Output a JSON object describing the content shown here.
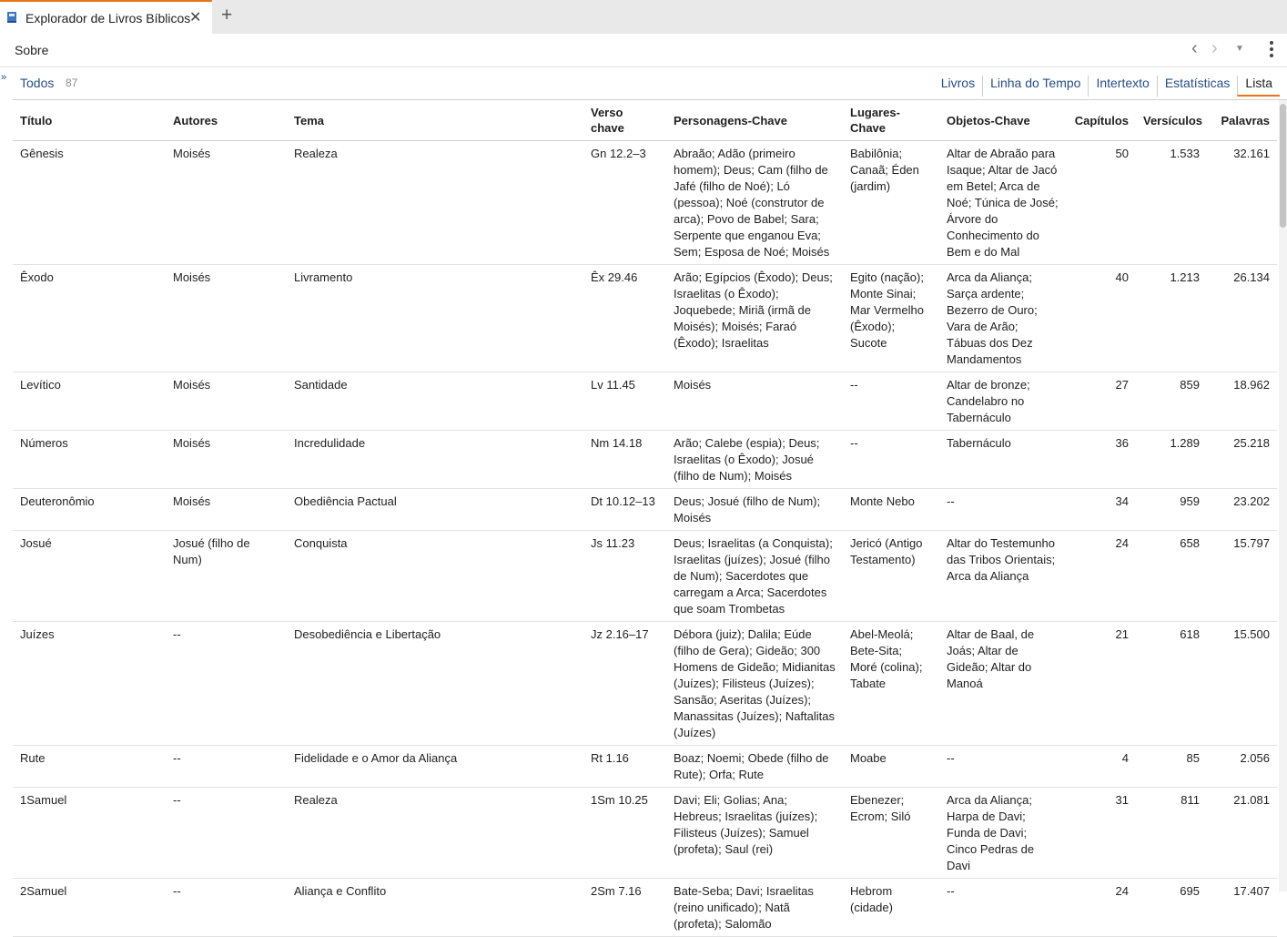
{
  "tab": {
    "title": "Explorador de Livros Bíblicos",
    "close_icon": "✕",
    "new_tab_icon": "+"
  },
  "toolbar": {
    "title": "Sobre",
    "back_icon": "‹",
    "forward_icon": "›",
    "dropdown_icon": "▼"
  },
  "sidebar_toggle_icon": "»",
  "filter": {
    "label": "Todos",
    "count": "87"
  },
  "views": [
    "Livros",
    "Linha do Tempo",
    "Intertexto",
    "Estatísticas",
    "Lista"
  ],
  "active_view": "Lista",
  "colors": {
    "accent": "#e8751a",
    "link": "#274f85"
  },
  "table": {
    "headers": {
      "title": "Título",
      "authors": "Autores",
      "theme": "Tema",
      "key_verse": "Verso chave",
      "characters": "Personagens-Chave",
      "places": "Lugares-Chave",
      "objects": "Objetos-Chave",
      "chapters": "Capítulos",
      "verses": "Versículos",
      "words": "Palavras"
    },
    "rows": [
      {
        "title": "Gênesis",
        "authors": "Moisés",
        "theme": "Realeza",
        "key_verse": "Gn 12.2–3",
        "characters": "Abraão; Adão (primeiro homem); Deus; Cam (filho de Jafé (filho de Noé); Ló (pessoa); Noé (construtor de arca); Povo de Babel; Sara; Serpente que enganou Eva; Sem; Esposa de Noé; Moisés",
        "places": "Babilônia; Canaã; Éden (jardim)",
        "objects": "Altar de Abraão para Isaque; Altar de Jacó em Betel; Arca de Noé; Túnica de José; Árvore do Conhecimento do Bem e do Mal",
        "chapters": "50",
        "verses": "1.533",
        "words": "32.161"
      },
      {
        "title": "Êxodo",
        "authors": "Moisés",
        "theme": "Livramento",
        "key_verse": "Êx 29.46",
        "characters": "Arão; Egípcios (Êxodo); Deus; Israelitas (o Êxodo); Joquebede; Miriã (irmã de Moisés); Moisés; Faraó (Êxodo); Israelitas",
        "places": "Egito (nação); Monte Sinai; Mar Vermelho (Êxodo); Sucote",
        "objects": "Arca da Aliança; Sarça ardente; Bezerro de Ouro; Vara de Arão; Tábuas dos Dez Mandamentos",
        "chapters": "40",
        "verses": "1.213",
        "words": "26.134"
      },
      {
        "title": "Levítico",
        "authors": "Moisés",
        "theme": "Santidade",
        "key_verse": "Lv 11.45",
        "characters": "Moisés",
        "places": "--",
        "objects": "Altar de bronze; Candelabro no Tabernáculo",
        "chapters": "27",
        "verses": "859",
        "words": "18.962"
      },
      {
        "title": "Números",
        "authors": "Moisés",
        "theme": "Incredulidade",
        "key_verse": "Nm 14.18",
        "characters": "Arão; Calebe (espia); Deus; Israelitas (o Êxodo); Josué (filho de Num); Moisés",
        "places": "--",
        "objects": "Tabernáculo",
        "chapters": "36",
        "verses": "1.289",
        "words": "25.218"
      },
      {
        "title": "Deuteronômio",
        "authors": "Moisés",
        "theme": "Obediência Pactual",
        "key_verse": "Dt 10.12–13",
        "characters": "Deus; Josué (filho de Num); Moisés",
        "places": "Monte Nebo",
        "objects": "--",
        "chapters": "34",
        "verses": "959",
        "words": "23.202"
      },
      {
        "title": "Josué",
        "authors": "Josué (filho de Num)",
        "theme": "Conquista",
        "key_verse": "Js 11.23",
        "characters": "Deus; Israelitas (a Conquista); Israelitas (juízes); Josué (filho de Num); Sacerdotes que carregam a Arca; Sacerdotes que soam Trombetas",
        "places": "Jericó (Antigo Testamento)",
        "objects": "Altar do Testemunho das Tribos Orientais; Arca da Aliança",
        "chapters": "24",
        "verses": "658",
        "words": "15.797"
      },
      {
        "title": "Juízes",
        "authors": "--",
        "theme": "Desobediência e Libertação",
        "key_verse": "Jz 2.16–17",
        "characters": "Débora (juiz); Dalila; Eúde (filho de Gera); Gideão; 300 Homens de Gideão; Midianitas (Juízes); Filisteus (Juízes); Sansão; Aseritas (Juízes); Manassitas (Juízes); Naftalitas (Juízes)",
        "places": "Abel-Meolá; Bete-Sita; Moré (colina); Tabate",
        "objects": "Altar de Baal, de Joás; Altar de Gideão; Altar do Manoá",
        "chapters": "21",
        "verses": "618",
        "words": "15.500"
      },
      {
        "title": "Rute",
        "authors": "--",
        "theme": "Fidelidade e o Amor da Aliança",
        "key_verse": "Rt 1.16",
        "characters": "Boaz; Noemi; Obede (filho de Rute); Orfa; Rute",
        "places": "Moabe",
        "objects": "--",
        "chapters": "4",
        "verses": "85",
        "words": "2.056"
      },
      {
        "title": "1Samuel",
        "authors": "--",
        "theme": "Realeza",
        "key_verse": "1Sm 10.25",
        "characters": "Davi; Eli; Golias; Ana; Hebreus; Israelitas (juízes); Filisteus (Juízes); Samuel (profeta); Saul (rei)",
        "places": "Ebenezer; Ecrom; Siló",
        "objects": "Arca da Aliança; Harpa de Davi; Funda de Davi; Cinco Pedras de Davi",
        "chapters": "31",
        "verses": "811",
        "words": "21.081"
      },
      {
        "title": "2Samuel",
        "authors": "--",
        "theme": "Aliança e Conflito",
        "key_verse": "2Sm 7.16",
        "characters": "Bate-Seba; Davi; Israelitas (reino unificado); Natã (profeta); Salomão",
        "places": "Hebrom (cidade)",
        "objects": "--",
        "chapters": "24",
        "verses": "695",
        "words": "17.407"
      }
    ]
  }
}
